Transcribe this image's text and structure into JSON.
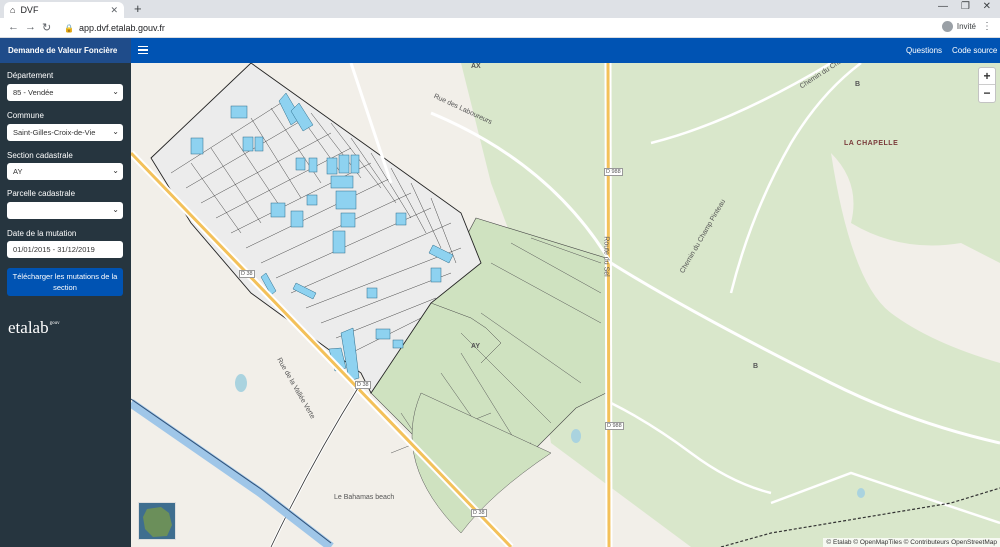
{
  "browser": {
    "tab_title": "DVF",
    "url": "app.dvf.etalab.gouv.fr",
    "profile": "Invité"
  },
  "header": {
    "brand": "Demande de Valeur Foncière",
    "links": [
      "Questions",
      "Code source"
    ]
  },
  "sidebar": {
    "departement": {
      "label": "Département",
      "value": "85 - Vendée"
    },
    "commune": {
      "label": "Commune",
      "value": "Saint-Gilles-Croix-de-Vie"
    },
    "section": {
      "label": "Section cadastrale",
      "value": "AY"
    },
    "parcelle": {
      "label": "Parcelle cadastrale",
      "value": ""
    },
    "date": {
      "label": "Date de la mutation",
      "value": "01/01/2015 - 31/12/2019"
    },
    "download_label": "Télécharger les mutations de la section",
    "logo": "etalab",
    "logo_sup": "gouv"
  },
  "map": {
    "labels": {
      "ax": "AX",
      "ay": "AY",
      "b_top": "B",
      "b_mid": "B",
      "la_chapelle": "LA CHAPELLE",
      "d988_top": "D 988",
      "d988_bottom": "D 988",
      "d38_left": "D 38",
      "d38_mid": "D 38",
      "d38_bottom": "D 38",
      "route_sel": "Route du Sel",
      "chemin_champ": "Chemin du Champ",
      "chemin_champ_pinteau": "Chemin du Champ Pinteau",
      "rue_laboureurs": "Rue des Laboureurs",
      "rue_vallee_verte": "Rue de la Vallée Verte",
      "bahamas": "Le Bahamas beach"
    },
    "zoom_in": "+",
    "zoom_out": "−",
    "attribution": "© Etalab © OpenMapTiles © Contributeurs OpenStreetMap",
    "colors": {
      "highlight": "#8ed2f0",
      "parcel": "#ececec",
      "green": "#cfe2c0",
      "background": "#f2efe9",
      "road_main": "#f3c15a"
    }
  }
}
